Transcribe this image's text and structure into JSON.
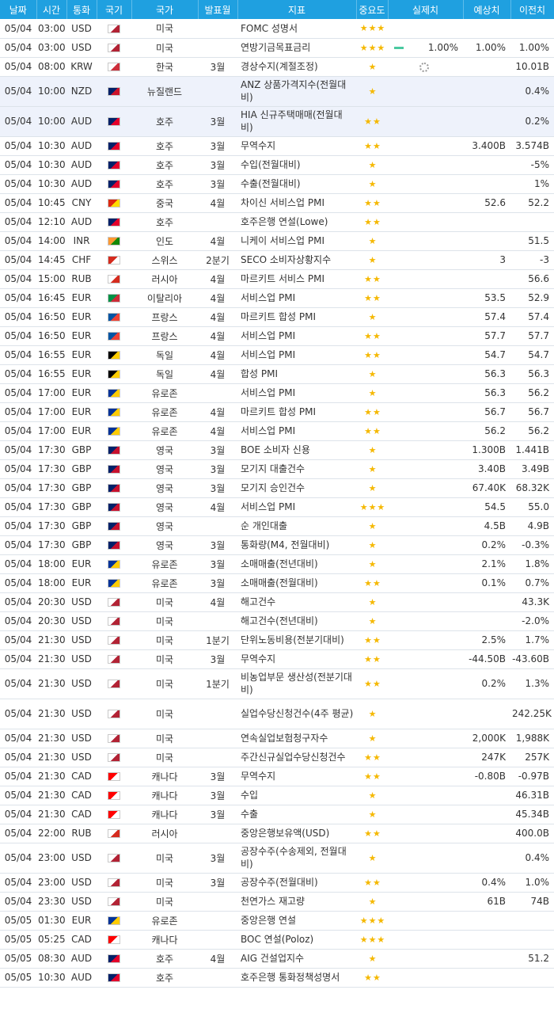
{
  "header": [
    "날짜",
    "시간",
    "통화",
    "국기",
    "국가",
    "발표월",
    "지표",
    "중요도",
    "실제치",
    "예상치",
    "이전치"
  ],
  "flags": {
    "USD": [
      "#ffffff",
      "#b22234"
    ],
    "KRW": [
      "#ffffff",
      "#cd2e3a"
    ],
    "NZD": [
      "#012169",
      "#cc142b"
    ],
    "AUD": [
      "#012169",
      "#e4002b"
    ],
    "CNY": [
      "#de2910",
      "#ffde00"
    ],
    "INR": [
      "#ff9933",
      "#138808"
    ],
    "CHF": [
      "#d52b1e",
      "#ffffff"
    ],
    "RUB": [
      "#ffffff",
      "#d52b1e"
    ],
    "EUR_IT": [
      "#009246",
      "#ce2b37"
    ],
    "EUR_FR": [
      "#0055a4",
      "#ef4135"
    ],
    "EUR_DE": [
      "#000000",
      "#ffce00"
    ],
    "EUR_EU": [
      "#003399",
      "#ffcc00"
    ],
    "GBP": [
      "#012169",
      "#c8102e"
    ],
    "CAD": [
      "#ff0000",
      "#ffffff"
    ]
  },
  "rows": [
    {
      "date": "05/04",
      "time": "03:00",
      "cur": "USD",
      "flag": "USD",
      "country": "미국",
      "month": "",
      "ind": "FOMC 성명서",
      "stars": 3,
      "actual": "",
      "forecast": "",
      "prev": ""
    },
    {
      "date": "05/04",
      "time": "03:00",
      "cur": "USD",
      "flag": "USD",
      "country": "미국",
      "month": "",
      "ind": "연방기금목표금리",
      "stars": 3,
      "actual": "1.00%",
      "forecast": "1.00%",
      "prev": "1.00%",
      "green": true
    },
    {
      "date": "05/04",
      "time": "08:00",
      "cur": "KRW",
      "flag": "KRW",
      "country": "한국",
      "month": "3월",
      "ind": "경상수지(계절조정)",
      "stars": 1,
      "actual": "",
      "forecast": "",
      "prev": "10.01B",
      "loading": true
    },
    {
      "date": "05/04",
      "time": "10:00",
      "cur": "NZD",
      "flag": "NZD",
      "country": "뉴질랜드",
      "month": "",
      "ind": "ANZ 상품가격지수(전월대비)",
      "stars": 1,
      "actual": "",
      "forecast": "",
      "prev": "0.4%",
      "tall": true,
      "hl": true
    },
    {
      "date": "05/04",
      "time": "10:00",
      "cur": "AUD",
      "flag": "AUD",
      "country": "호주",
      "month": "3월",
      "ind": "HIA 신규주택매매(전월대비)",
      "stars": 2,
      "actual": "",
      "forecast": "",
      "prev": "0.2%",
      "tall": true,
      "hl": true
    },
    {
      "date": "05/04",
      "time": "10:30",
      "cur": "AUD",
      "flag": "AUD",
      "country": "호주",
      "month": "3월",
      "ind": "무역수지",
      "stars": 2,
      "actual": "",
      "forecast": "3.400B",
      "prev": "3.574B"
    },
    {
      "date": "05/04",
      "time": "10:30",
      "cur": "AUD",
      "flag": "AUD",
      "country": "호주",
      "month": "3월",
      "ind": "수입(전월대비)",
      "stars": 1,
      "actual": "",
      "forecast": "",
      "prev": "-5%"
    },
    {
      "date": "05/04",
      "time": "10:30",
      "cur": "AUD",
      "flag": "AUD",
      "country": "호주",
      "month": "3월",
      "ind": "수출(전월대비)",
      "stars": 1,
      "actual": "",
      "forecast": "",
      "prev": "1%"
    },
    {
      "date": "05/04",
      "time": "10:45",
      "cur": "CNY",
      "flag": "CNY",
      "country": "중국",
      "month": "4월",
      "ind": "차이신 서비스업 PMI",
      "stars": 2,
      "actual": "",
      "forecast": "52.6",
      "prev": "52.2"
    },
    {
      "date": "05/04",
      "time": "12:10",
      "cur": "AUD",
      "flag": "AUD",
      "country": "호주",
      "month": "",
      "ind": "호주은행 연설(Lowe)",
      "stars": 2,
      "actual": "",
      "forecast": "",
      "prev": ""
    },
    {
      "date": "05/04",
      "time": "14:00",
      "cur": "INR",
      "flag": "INR",
      "country": "인도",
      "month": "4월",
      "ind": "니케이 서비스업 PMI",
      "stars": 1,
      "actual": "",
      "forecast": "",
      "prev": "51.5"
    },
    {
      "date": "05/04",
      "time": "14:45",
      "cur": "CHF",
      "flag": "CHF",
      "country": "스위스",
      "month": "2분기",
      "ind": "SECO 소비자상황지수",
      "stars": 1,
      "actual": "",
      "forecast": "3",
      "prev": "-3"
    },
    {
      "date": "05/04",
      "time": "15:00",
      "cur": "RUB",
      "flag": "RUB",
      "country": "러시아",
      "month": "4월",
      "ind": "마르키트 서비스 PMI",
      "stars": 2,
      "actual": "",
      "forecast": "",
      "prev": "56.6"
    },
    {
      "date": "05/04",
      "time": "16:45",
      "cur": "EUR",
      "flag": "EUR_IT",
      "country": "이탈리아",
      "month": "4월",
      "ind": "서비스업 PMI",
      "stars": 2,
      "actual": "",
      "forecast": "53.5",
      "prev": "52.9"
    },
    {
      "date": "05/04",
      "time": "16:50",
      "cur": "EUR",
      "flag": "EUR_FR",
      "country": "프랑스",
      "month": "4월",
      "ind": "마르키트 합성 PMI",
      "stars": 1,
      "actual": "",
      "forecast": "57.4",
      "prev": "57.4"
    },
    {
      "date": "05/04",
      "time": "16:50",
      "cur": "EUR",
      "flag": "EUR_FR",
      "country": "프랑스",
      "month": "4월",
      "ind": "서비스업 PMI",
      "stars": 2,
      "actual": "",
      "forecast": "57.7",
      "prev": "57.7"
    },
    {
      "date": "05/04",
      "time": "16:55",
      "cur": "EUR",
      "flag": "EUR_DE",
      "country": "독일",
      "month": "4월",
      "ind": "서비스업 PMI",
      "stars": 2,
      "actual": "",
      "forecast": "54.7",
      "prev": "54.7"
    },
    {
      "date": "05/04",
      "time": "16:55",
      "cur": "EUR",
      "flag": "EUR_DE",
      "country": "독일",
      "month": "4월",
      "ind": "합성 PMI",
      "stars": 1,
      "actual": "",
      "forecast": "56.3",
      "prev": "56.3"
    },
    {
      "date": "05/04",
      "time": "17:00",
      "cur": "EUR",
      "flag": "EUR_EU",
      "country": "유로존",
      "month": "",
      "ind": "서비스업 PMI",
      "stars": 1,
      "actual": "",
      "forecast": "56.3",
      "prev": "56.2"
    },
    {
      "date": "05/04",
      "time": "17:00",
      "cur": "EUR",
      "flag": "EUR_EU",
      "country": "유로존",
      "month": "4월",
      "ind": "마르키트 합성 PMI",
      "stars": 2,
      "actual": "",
      "forecast": "56.7",
      "prev": "56.7"
    },
    {
      "date": "05/04",
      "time": "17:00",
      "cur": "EUR",
      "flag": "EUR_EU",
      "country": "유로존",
      "month": "4월",
      "ind": "서비스업 PMI",
      "stars": 2,
      "actual": "",
      "forecast": "56.2",
      "prev": "56.2"
    },
    {
      "date": "05/04",
      "time": "17:30",
      "cur": "GBP",
      "flag": "GBP",
      "country": "영국",
      "month": "3월",
      "ind": "BOE 소비자 신용",
      "stars": 1,
      "actual": "",
      "forecast": "1.300B",
      "prev": "1.441B"
    },
    {
      "date": "05/04",
      "time": "17:30",
      "cur": "GBP",
      "flag": "GBP",
      "country": "영국",
      "month": "3월",
      "ind": "모기지 대출건수",
      "stars": 1,
      "actual": "",
      "forecast": "3.40B",
      "prev": "3.49B"
    },
    {
      "date": "05/04",
      "time": "17:30",
      "cur": "GBP",
      "flag": "GBP",
      "country": "영국",
      "month": "3월",
      "ind": "모기지 승인건수",
      "stars": 1,
      "actual": "",
      "forecast": "67.40K",
      "prev": "68.32K"
    },
    {
      "date": "05/04",
      "time": "17:30",
      "cur": "GBP",
      "flag": "GBP",
      "country": "영국",
      "month": "4월",
      "ind": "서비스업 PMI",
      "stars": 3,
      "actual": "",
      "forecast": "54.5",
      "prev": "55.0"
    },
    {
      "date": "05/04",
      "time": "17:30",
      "cur": "GBP",
      "flag": "GBP",
      "country": "영국",
      "month": "",
      "ind": "순 개인대출",
      "stars": 1,
      "actual": "",
      "forecast": "4.5B",
      "prev": "4.9B"
    },
    {
      "date": "05/04",
      "time": "17:30",
      "cur": "GBP",
      "flag": "GBP",
      "country": "영국",
      "month": "3월",
      "ind": "통화량(M4, 전월대비)",
      "stars": 1,
      "actual": "",
      "forecast": "0.2%",
      "prev": "-0.3%"
    },
    {
      "date": "05/04",
      "time": "18:00",
      "cur": "EUR",
      "flag": "EUR_EU",
      "country": "유로존",
      "month": "3월",
      "ind": "소매매출(전년대비)",
      "stars": 1,
      "actual": "",
      "forecast": "2.1%",
      "prev": "1.8%"
    },
    {
      "date": "05/04",
      "time": "18:00",
      "cur": "EUR",
      "flag": "EUR_EU",
      "country": "유로존",
      "month": "3월",
      "ind": "소매매출(전월대비)",
      "stars": 2,
      "actual": "",
      "forecast": "0.1%",
      "prev": "0.7%"
    },
    {
      "date": "05/04",
      "time": "20:30",
      "cur": "USD",
      "flag": "USD",
      "country": "미국",
      "month": "4월",
      "ind": "해고건수",
      "stars": 1,
      "actual": "",
      "forecast": "",
      "prev": "43.3K"
    },
    {
      "date": "05/04",
      "time": "20:30",
      "cur": "USD",
      "flag": "USD",
      "country": "미국",
      "month": "",
      "ind": "해고건수(전년대비)",
      "stars": 1,
      "actual": "",
      "forecast": "",
      "prev": "-2.0%"
    },
    {
      "date": "05/04",
      "time": "21:30",
      "cur": "USD",
      "flag": "USD",
      "country": "미국",
      "month": "1분기",
      "ind": "단위노동비용(전분기대비)",
      "stars": 2,
      "actual": "",
      "forecast": "2.5%",
      "prev": "1.7%"
    },
    {
      "date": "05/04",
      "time": "21:30",
      "cur": "USD",
      "flag": "USD",
      "country": "미국",
      "month": "3월",
      "ind": "무역수지",
      "stars": 2,
      "actual": "",
      "forecast": "-44.50B",
      "prev": "-43.60B"
    },
    {
      "date": "05/04",
      "time": "21:30",
      "cur": "USD",
      "flag": "USD",
      "country": "미국",
      "month": "1분기",
      "ind": "비농업부문 생산성(전분기대비)",
      "stars": 2,
      "actual": "",
      "forecast": "0.2%",
      "prev": "1.3%",
      "tall": true
    },
    {
      "date": "05/04",
      "time": "21:30",
      "cur": "USD",
      "flag": "USD",
      "country": "미국",
      "month": "",
      "ind": "실업수당신청건수(4주 평균)",
      "stars": 1,
      "actual": "",
      "forecast": "",
      "prev": "242.25K",
      "tall": true
    },
    {
      "date": "05/04",
      "time": "21:30",
      "cur": "USD",
      "flag": "USD",
      "country": "미국",
      "month": "",
      "ind": "연속실업보험청구자수",
      "stars": 1,
      "actual": "",
      "forecast": "2,000K",
      "prev": "1,988K"
    },
    {
      "date": "05/04",
      "time": "21:30",
      "cur": "USD",
      "flag": "USD",
      "country": "미국",
      "month": "",
      "ind": "주간신규실업수당신청건수",
      "stars": 2,
      "actual": "",
      "forecast": "247K",
      "prev": "257K"
    },
    {
      "date": "05/04",
      "time": "21:30",
      "cur": "CAD",
      "flag": "CAD",
      "country": "캐나다",
      "month": "3월",
      "ind": "무역수지",
      "stars": 2,
      "actual": "",
      "forecast": "-0.80B",
      "prev": "-0.97B"
    },
    {
      "date": "05/04",
      "time": "21:30",
      "cur": "CAD",
      "flag": "CAD",
      "country": "캐나다",
      "month": "3월",
      "ind": "수입",
      "stars": 1,
      "actual": "",
      "forecast": "",
      "prev": "46.31B"
    },
    {
      "date": "05/04",
      "time": "21:30",
      "cur": "CAD",
      "flag": "CAD",
      "country": "캐나다",
      "month": "3월",
      "ind": "수출",
      "stars": 1,
      "actual": "",
      "forecast": "",
      "prev": "45.34B"
    },
    {
      "date": "05/04",
      "time": "22:00",
      "cur": "RUB",
      "flag": "RUB",
      "country": "러시아",
      "month": "",
      "ind": "중앙은행보유액(USD)",
      "stars": 2,
      "actual": "",
      "forecast": "",
      "prev": "400.0B"
    },
    {
      "date": "05/04",
      "time": "23:00",
      "cur": "USD",
      "flag": "USD",
      "country": "미국",
      "month": "3월",
      "ind": "공장수주(수송제외, 전월대비)",
      "stars": 1,
      "actual": "",
      "forecast": "",
      "prev": "0.4%",
      "tall": true
    },
    {
      "date": "05/04",
      "time": "23:00",
      "cur": "USD",
      "flag": "USD",
      "country": "미국",
      "month": "3월",
      "ind": "공장수주(전월대비)",
      "stars": 2,
      "actual": "",
      "forecast": "0.4%",
      "prev": "1.0%"
    },
    {
      "date": "05/04",
      "time": "23:30",
      "cur": "USD",
      "flag": "USD",
      "country": "미국",
      "month": "",
      "ind": "천연가스 재고량",
      "stars": 1,
      "actual": "",
      "forecast": "61B",
      "prev": "74B"
    },
    {
      "date": "05/05",
      "time": "01:30",
      "cur": "EUR",
      "flag": "EUR_EU",
      "country": "유로존",
      "month": "",
      "ind": "중앙은행 연설",
      "stars": 3,
      "actual": "",
      "forecast": "",
      "prev": ""
    },
    {
      "date": "05/05",
      "time": "05:25",
      "cur": "CAD",
      "flag": "CAD",
      "country": "캐나다",
      "month": "",
      "ind": "BOC 연설(Poloz)",
      "stars": 3,
      "actual": "",
      "forecast": "",
      "prev": ""
    },
    {
      "date": "05/05",
      "time": "08:30",
      "cur": "AUD",
      "flag": "AUD",
      "country": "호주",
      "month": "4월",
      "ind": "AIG 건설업지수",
      "stars": 1,
      "actual": "",
      "forecast": "",
      "prev": "51.2"
    },
    {
      "date": "05/05",
      "time": "10:30",
      "cur": "AUD",
      "flag": "AUD",
      "country": "호주",
      "month": "",
      "ind": "호주은행 통화정책성명서",
      "stars": 2,
      "actual": "",
      "forecast": "",
      "prev": ""
    }
  ]
}
